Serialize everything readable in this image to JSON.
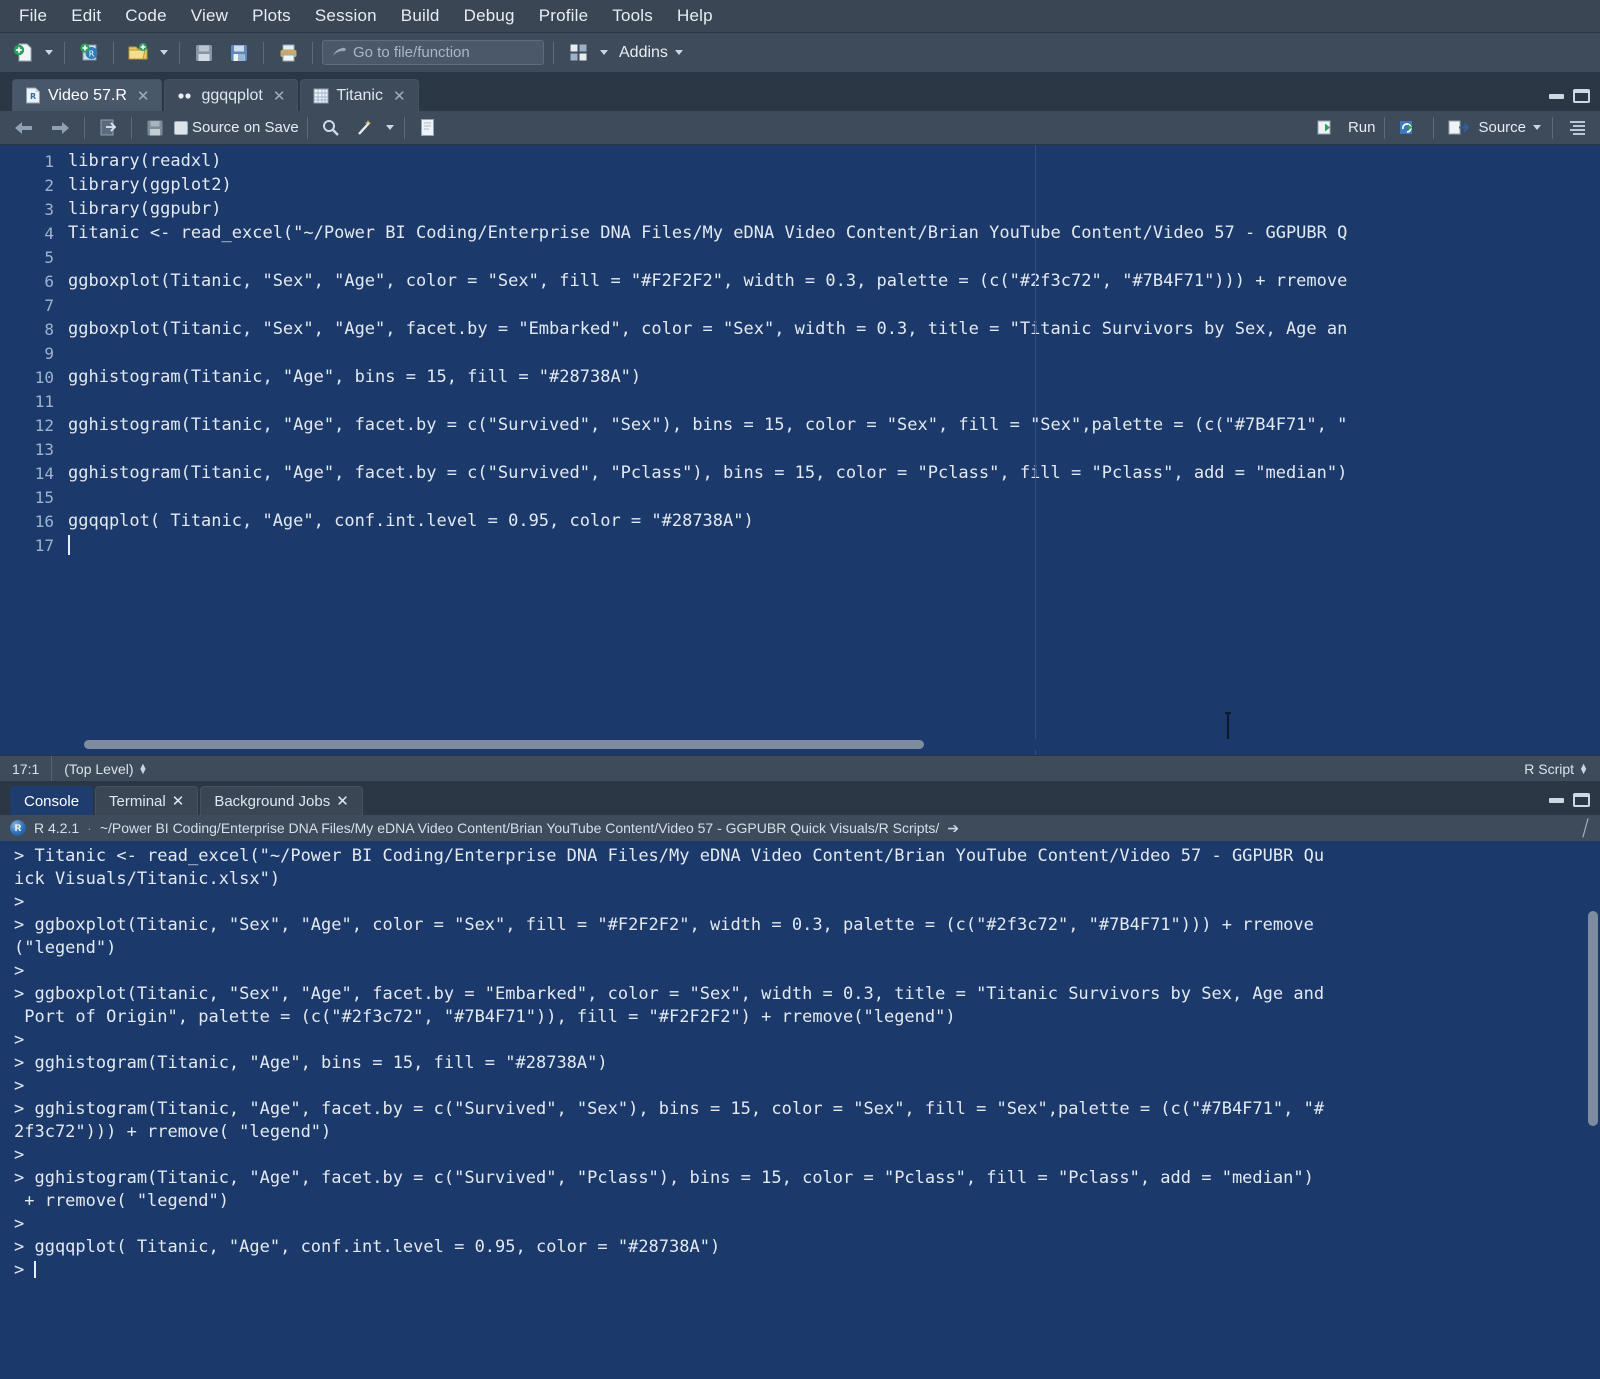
{
  "menu": {
    "items": [
      {
        "label": "File"
      },
      {
        "label": "Edit"
      },
      {
        "label": "Code"
      },
      {
        "label": "View"
      },
      {
        "label": "Plots"
      },
      {
        "label": "Session"
      },
      {
        "label": "Build"
      },
      {
        "label": "Debug"
      },
      {
        "label": "Profile"
      },
      {
        "label": "Tools"
      },
      {
        "label": "Help"
      }
    ]
  },
  "toolbar": {
    "goto_placeholder": "Go to file/function",
    "addins_label": "Addins",
    "icons": [
      "new-file-icon",
      "new-project-icon",
      "open-file-icon",
      "save-icon",
      "save-all-icon",
      "print-icon",
      "grid-icon"
    ]
  },
  "source": {
    "tabs": [
      {
        "label": "Video 57.R",
        "icon": "r-script-icon",
        "active": true,
        "closable": true
      },
      {
        "label": "ggqqplot",
        "icon": "plot-dots-icon",
        "active": false,
        "closable": true
      },
      {
        "label": "Titanic",
        "icon": "data-grid-icon",
        "active": false,
        "closable": true
      }
    ],
    "editor_toolbar": {
      "back_label": "back-arrow",
      "forward_label": "forward-arrow",
      "source_on_save_label": "Source on Save",
      "run_label": "Run",
      "source_label": "Source"
    },
    "code": [
      {
        "n": "1",
        "text": "library(readxl)"
      },
      {
        "n": "2",
        "text": "library(ggplot2)"
      },
      {
        "n": "3",
        "text": "library(ggpubr)"
      },
      {
        "n": "4",
        "text": "Titanic <- read_excel(\"~/Power BI Coding/Enterprise DNA Files/My eDNA Video Content/Brian YouTube Content/Video 57 - GGPUBR Q"
      },
      {
        "n": "5",
        "text": ""
      },
      {
        "n": "6",
        "text": "ggboxplot(Titanic, \"Sex\", \"Age\", color = \"Sex\", fill = \"#F2F2F2\", width = 0.3, palette = (c(\"#2f3c72\", \"#7B4F71\"))) + rremove"
      },
      {
        "n": "7",
        "text": ""
      },
      {
        "n": "8",
        "text": "ggboxplot(Titanic, \"Sex\", \"Age\", facet.by = \"Embarked\", color = \"Sex\", width = 0.3, title = \"Titanic Survivors by Sex, Age an"
      },
      {
        "n": "9",
        "text": ""
      },
      {
        "n": "10",
        "text": "gghistogram(Titanic, \"Age\", bins = 15, fill = \"#28738A\")"
      },
      {
        "n": "11",
        "text": ""
      },
      {
        "n": "12",
        "text": "gghistogram(Titanic, \"Age\", facet.by = c(\"Survived\", \"Sex\"), bins = 15, color = \"Sex\", fill = \"Sex\",palette = (c(\"#7B4F71\", \""
      },
      {
        "n": "13",
        "text": ""
      },
      {
        "n": "14",
        "text": "gghistogram(Titanic, \"Age\", facet.by = c(\"Survived\", \"Pclass\"), bins = 15, color = \"Pclass\", fill = \"Pclass\", add = \"median\")"
      },
      {
        "n": "15",
        "text": ""
      },
      {
        "n": "16",
        "text": "ggqqplot( Titanic, \"Age\", conf.int.level = 0.95, color = \"#28738A\")"
      },
      {
        "n": "17",
        "text": ""
      }
    ],
    "statusbar": {
      "position": "17:1",
      "scope": "(Top Level)",
      "filetype": "R Script"
    }
  },
  "console": {
    "tabs": [
      {
        "label": "Console",
        "active": true,
        "closable": false
      },
      {
        "label": "Terminal",
        "active": false,
        "closable": true
      },
      {
        "label": "Background Jobs",
        "active": false,
        "closable": true
      }
    ],
    "header": {
      "r_version": "R 4.2.1",
      "separator": "·",
      "working_dir": "~/Power BI Coding/Enterprise DNA Files/My eDNA Video Content/Brian YouTube Content/Video 57 - GGPUBR Quick Visuals/R Scripts/"
    },
    "output": [
      "> Titanic <- read_excel(\"~/Power BI Coding/Enterprise DNA Files/My eDNA Video Content/Brian YouTube Content/Video 57 - GGPUBR Qu",
      "ick Visuals/Titanic.xlsx\")",
      ">",
      "> ggboxplot(Titanic, \"Sex\", \"Age\", color = \"Sex\", fill = \"#F2F2F2\", width = 0.3, palette = (c(\"#2f3c72\", \"#7B4F71\"))) + rremove",
      "(\"legend\")",
      ">",
      "> ggboxplot(Titanic, \"Sex\", \"Age\", facet.by = \"Embarked\", color = \"Sex\", width = 0.3, title = \"Titanic Survivors by Sex, Age and",
      " Port of Origin\", palette = (c(\"#2f3c72\", \"#7B4F71\")), fill = \"#F2F2F2\") + rremove(\"legend\")",
      ">",
      "> gghistogram(Titanic, \"Age\", bins = 15, fill = \"#28738A\")",
      ">",
      "> gghistogram(Titanic, \"Age\", facet.by = c(\"Survived\", \"Sex\"), bins = 15, color = \"Sex\", fill = \"Sex\",palette = (c(\"#7B4F71\", \"#",
      "2f3c72\"))) + rremove( \"legend\")",
      ">",
      "> gghistogram(Titanic, \"Age\", facet.by = c(\"Survived\", \"Pclass\"), bins = 15, color = \"Pclass\", fill = \"Pclass\", add = \"median\")",
      " + rremove( \"legend\")",
      ">",
      "> ggqqplot( Titanic, \"Age\", conf.int.level = 0.95, color = \"#28738A\")",
      "> "
    ]
  },
  "colors": {
    "editor_bg": "#1b3a6b",
    "chrome_bg": "#3e4b5a",
    "accent_teal": "#28738A",
    "palette_navy": "#2f3c72",
    "palette_plum": "#7B4F71"
  }
}
